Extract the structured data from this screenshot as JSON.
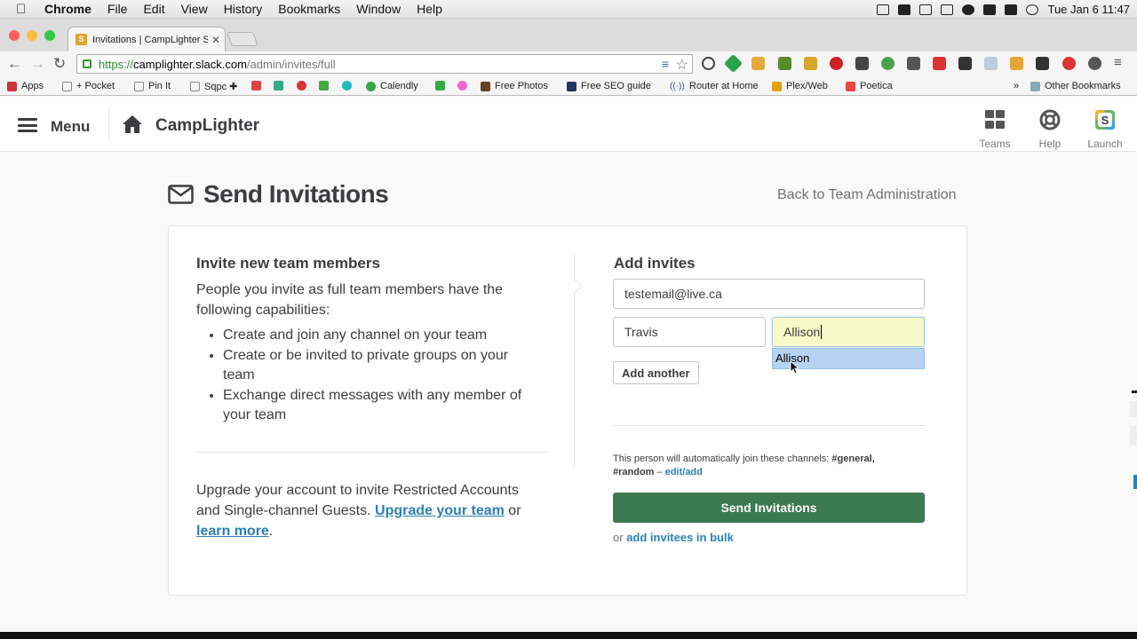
{
  "os_menu": {
    "app": "Chrome",
    "items": [
      "File",
      "Edit",
      "View",
      "History",
      "Bookmarks",
      "Window",
      "Help"
    ],
    "clock": "Tue Jan 6  11:47"
  },
  "browser": {
    "tab_title": "Invitations | CampLighter S",
    "tab_favicon": "S",
    "url_scheme": "https://",
    "url_host": "camplighter.slack.com",
    "url_path": "/admin/invites/full",
    "bookmarks": [
      "Apps",
      "+ Pocket",
      "Pin It",
      "Sqpc ✚",
      "Calendly",
      "Free Photos",
      "Free SEO guide",
      "Router at Home",
      "Plex/Web",
      "Poetica"
    ],
    "more_bookmarks": "»",
    "other_bookmarks": "Other Bookmarks"
  },
  "header": {
    "menu_label": "Menu",
    "team_name": "CampLighter",
    "buttons": [
      {
        "label": "Teams",
        "icon": "grid-icon"
      },
      {
        "label": "Help",
        "icon": "lifebuoy-icon"
      },
      {
        "label": "Launch",
        "icon": "slack-logo-icon"
      }
    ]
  },
  "page": {
    "title": "Send Invitations",
    "back_link": "Back to Team Administration"
  },
  "left": {
    "title": "Invite new team members",
    "description": "People you invite as full team members have the following capabilities:",
    "capabilities": [
      "Create and join any channel on your team",
      "Create or be invited to private groups on your team",
      "Exchange direct messages with any member of your team"
    ],
    "upgrade_text": "Upgrade your account to invite Restricted Accounts and Single-channel Guests.",
    "upgrade_link": "Upgrade your team",
    "or": "or",
    "learn_more": "learn more",
    "period": "."
  },
  "right": {
    "title": "Add invites",
    "email_value": "testemail@live.ca",
    "first_name_value": "Travis",
    "last_name_value": "Allison",
    "autocomplete_suggestion": "Allison",
    "add_another": "Add another",
    "channels_text": "This person will automatically join these channels:",
    "channel_general": "#general,",
    "channel_random": "#random",
    "dash": " – ",
    "edit_add": "edit/add",
    "send_button": "Send Invitations",
    "bulk_prefix": "or",
    "bulk_link": "add invitees in bulk"
  },
  "colors": {
    "send_button": "#3c7950",
    "link": "#2a80b9",
    "autocomplete_bg": "#b6d3f3",
    "focused_input_bg": "#fafac8"
  }
}
